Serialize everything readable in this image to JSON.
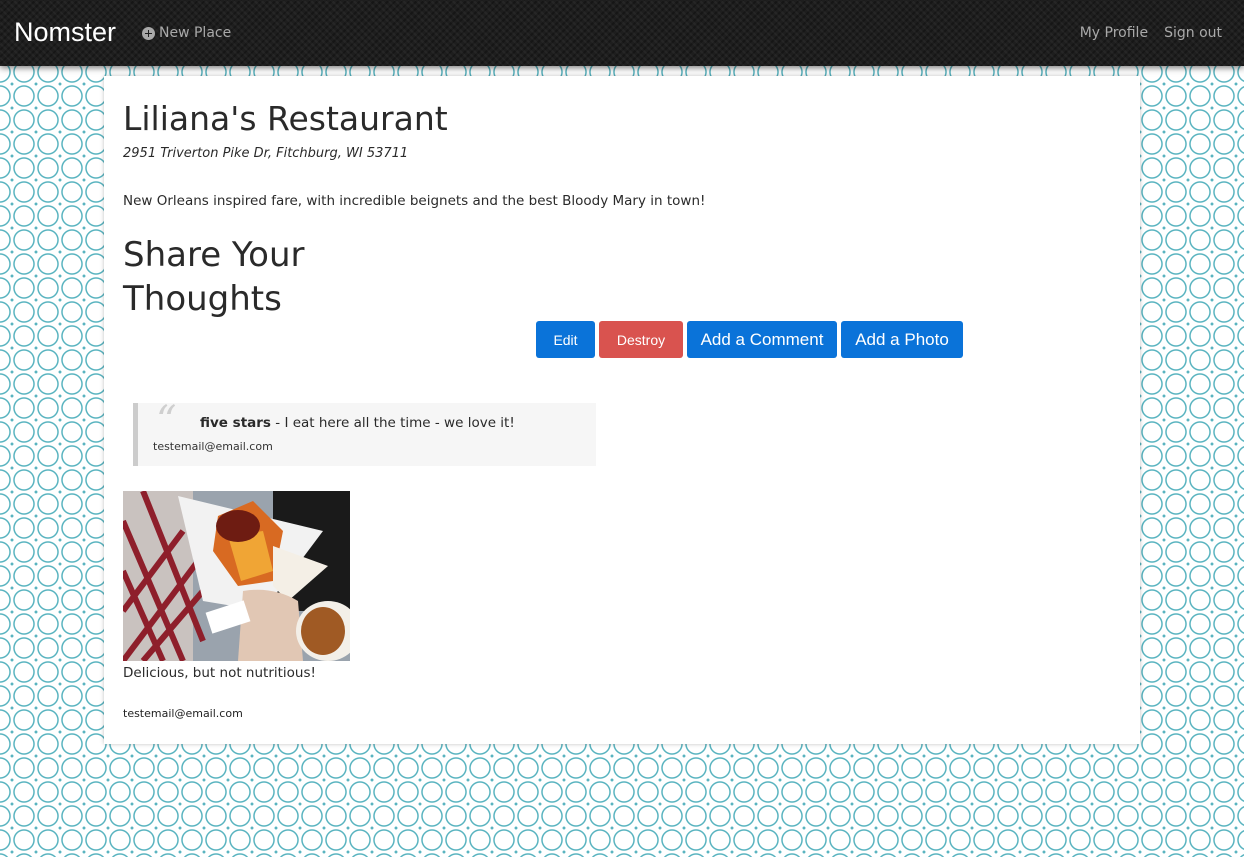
{
  "navbar": {
    "brand": "Nomster",
    "new_place": "New Place",
    "new_place_icon": "plus-circle-icon",
    "my_profile": "My Profile",
    "sign_out": "Sign out"
  },
  "place": {
    "name": "Liliana's Restaurant",
    "address": "2951 Triverton Pike Dr, Fitchburg, WI 53711",
    "description": "New Orleans inspired fare, with incredible beignets and the best Bloody Mary in town!"
  },
  "share_heading": "Share Your Thoughts",
  "actions": {
    "edit": "Edit",
    "destroy": "Destroy",
    "add_comment": "Add a Comment",
    "add_photo": "Add a Photo"
  },
  "comments": [
    {
      "rating": "five stars",
      "separator": " - ",
      "message": "I eat here all the time - we love it!",
      "author": "testemail@email.com"
    }
  ],
  "photos": [
    {
      "caption": "Delicious, but not nutritious!",
      "author": "testemail@email.com"
    }
  ],
  "colors": {
    "primary": "#0a73d9",
    "danger": "#d9534f",
    "navbar": "#1e1e1e",
    "pattern": "#5ab4c0"
  }
}
